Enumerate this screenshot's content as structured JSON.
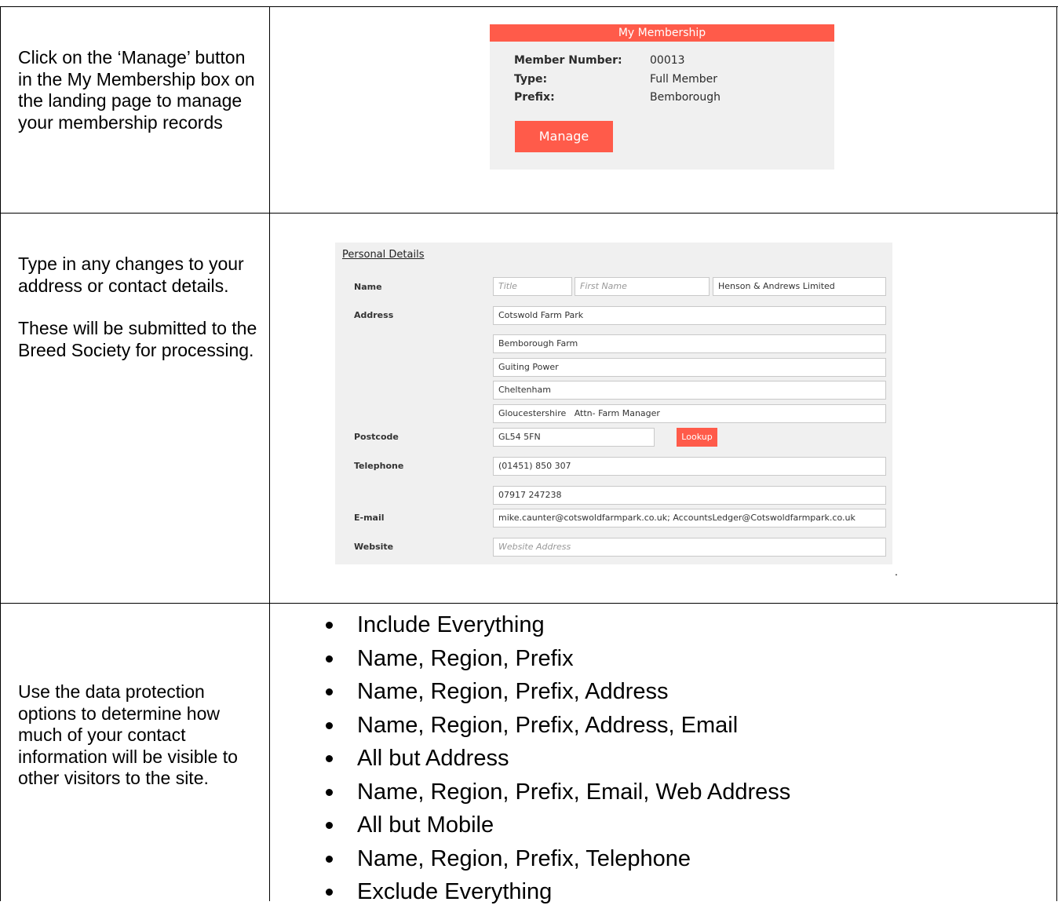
{
  "row1": {
    "instruction": "Click on the ‘Manage’ button in the My Membership box on the landing page to manage your membership records",
    "membership_box": {
      "title": "My Membership",
      "fields": [
        {
          "label": "Member Number:",
          "value": "00013"
        },
        {
          "label": "Type:",
          "value": "Full Member"
        },
        {
          "label": "Prefix:",
          "value": "Bemborough"
        }
      ],
      "button_label": "Manage"
    }
  },
  "row2": {
    "instruction_1": "Type in any changes to your address or contact details.",
    "instruction_2": "These will be submitted to the Breed Society for processing.",
    "form": {
      "title": "Personal Details",
      "labels": {
        "name": "Name",
        "address": "Address",
        "postcode": "Postcode",
        "telephone": "Telephone",
        "email": "E-mail",
        "website": "Website"
      },
      "name_title_placeholder": "Title",
      "name_first_placeholder": "First Name",
      "name_last_value": "Henson & Andrews Limited",
      "address_lines": [
        "Cotswold Farm Park",
        "Bemborough Farm",
        "Guiting Power",
        "Cheltenham",
        "Gloucestershire   Attn- Farm Manager"
      ],
      "postcode_value": "GL54 5FN",
      "lookup_label": "Lookup",
      "telephone_1": "(01451) 850 307",
      "telephone_2": "07917 247238",
      "email_value": "mike.caunter@cotswoldfarmpark.co.uk; AccountsLedger@Cotswoldfarmpark.co.uk",
      "website_placeholder": "Website Address"
    },
    "trailing_mark": "."
  },
  "row3": {
    "instruction": "Use the data protection options to determine how much of your contact information will be visible to other visitors to the site.",
    "options": [
      "Include Everything",
      "Name, Region, Prefix",
      "Name, Region, Prefix, Address",
      "Name, Region, Prefix, Address, Email",
      "All but Address",
      "Name, Region, Prefix, Email, Web Address",
      "All but Mobile",
      "Name, Region, Prefix, Telephone",
      "Exclude Everything"
    ]
  }
}
